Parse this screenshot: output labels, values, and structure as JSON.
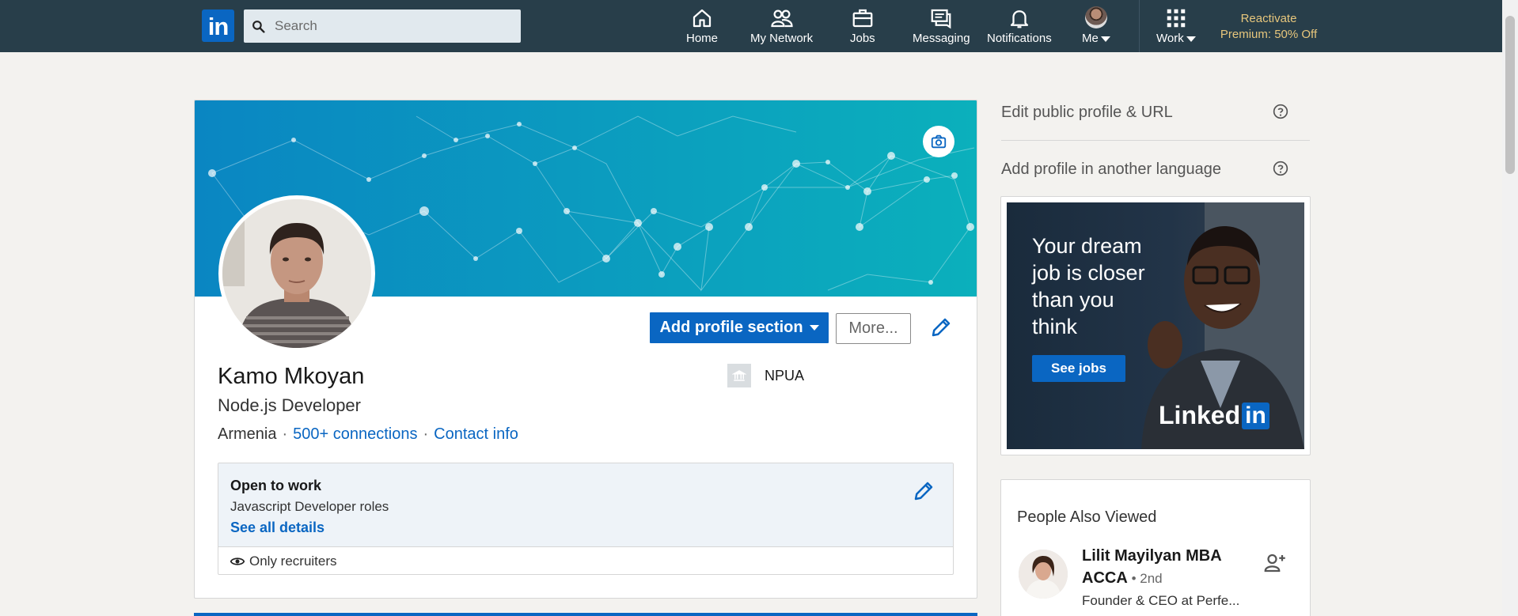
{
  "nav": {
    "logo": "in",
    "search_placeholder": "Search",
    "items": [
      {
        "label": "Home",
        "icon": "home-icon"
      },
      {
        "label": "My Network",
        "icon": "network-icon"
      },
      {
        "label": "Jobs",
        "icon": "briefcase-icon"
      },
      {
        "label": "Messaging",
        "icon": "messaging-icon"
      },
      {
        "label": "Notifications",
        "icon": "bell-icon"
      },
      {
        "label": "Me",
        "icon": "avatar"
      },
      {
        "label": "Work",
        "icon": "grid-icon"
      }
    ],
    "premium_line1": "Reactivate",
    "premium_line2": "Premium: 50% Off"
  },
  "profile": {
    "name": "Kamo Mkoyan",
    "headline": "Node.js Developer",
    "location": "Armenia",
    "connections": "500+ connections",
    "contact": "Contact info",
    "education": "NPUA",
    "add_section_label": "Add profile section",
    "more_label": "More..."
  },
  "open_to_work": {
    "title": "Open to work",
    "roles": "Javascript Developer roles",
    "link": "See all details",
    "visibility": "Only recruiters"
  },
  "rail": {
    "edit_public": "Edit public profile & URL",
    "add_language": "Add profile in another language"
  },
  "ad": {
    "line1": "Your dream",
    "line2": "job is closer",
    "line3": "than you",
    "line4": "think",
    "button": "See jobs",
    "brand": "Linked",
    "brand_in": "in"
  },
  "people_also_viewed": {
    "title": "People Also Viewed",
    "person_name": "Lilit Mayilyan MBA ACCA",
    "degree": "• 2nd",
    "subtitle": "Founder & CEO at Perfe..."
  },
  "colors": {
    "nav_bg": "#283e4a",
    "brand_blue": "#0a66c2",
    "premium_gold": "#e7c67c"
  }
}
